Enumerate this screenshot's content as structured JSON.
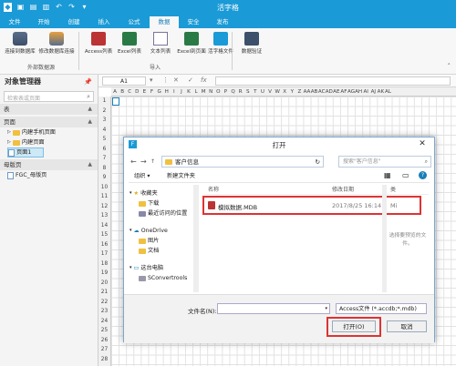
{
  "app": {
    "title": "活字格"
  },
  "tabs": [
    "文件",
    "开始",
    "创建",
    "插入",
    "公式",
    "数据",
    "安全",
    "发布"
  ],
  "active_tab": "数据",
  "ribbon": {
    "btn1": "连接到数据库",
    "btn2": "修改数据库连接",
    "grp1": "外部数据源",
    "btn3": "Access列表",
    "btn4": "Excel列表",
    "btn5": "文本列表",
    "btn6": "Excel到页面",
    "btn7": "活字格文件",
    "grp2": "导入",
    "btn8": "数据验证"
  },
  "sidebar": {
    "title": "对象管理器",
    "search_placeholder": "检索表或页面",
    "sec_table": "表",
    "sec_page": "页面",
    "items": [
      "内建手机页面",
      "内建页面",
      "页面1"
    ],
    "sec_master": "母版页",
    "master_item": "FGC_母版页"
  },
  "formula": {
    "cell": "A1",
    "fx": "fx"
  },
  "grid": {
    "cols": [
      "A",
      "B",
      "C",
      "D",
      "E",
      "F",
      "G",
      "H",
      "I",
      "J",
      "K",
      "L",
      "M",
      "N",
      "O",
      "P",
      "Q",
      "R",
      "S",
      "T",
      "U",
      "V",
      "W",
      "X",
      "Y",
      "Z",
      "AA",
      "AB",
      "AC",
      "AD",
      "AE",
      "AF",
      "AG",
      "AH",
      "AI",
      "AJ",
      "AK",
      "AL"
    ],
    "rows": [
      "1",
      "2",
      "3",
      "4",
      "5",
      "6",
      "7",
      "8",
      "9",
      "10",
      "11",
      "12",
      "13",
      "14",
      "15",
      "16",
      "17",
      "18",
      "19",
      "20",
      "21",
      "22",
      "23",
      "24",
      "25",
      "26",
      "27",
      "28",
      "29"
    ]
  },
  "dialog": {
    "title": "打开",
    "path": "客户信息",
    "search": "搜索\"客户信息\"",
    "organize": "组织 ▾",
    "new_folder": "新建文件夹",
    "left": {
      "favorites": "收藏夹",
      "downloads": "下载",
      "recent": "最近访问的位置",
      "onedrive": "OneDrive",
      "pictures": "图片",
      "documents": "文档",
      "thispc": "这台电脑",
      "drive": "SConvertrools"
    },
    "cols": {
      "name": "名称",
      "date": "修改日期",
      "type": "类"
    },
    "file": {
      "name": "模拟数据.MDB",
      "date": "2017/8/25 16:14",
      "type": "Mi"
    },
    "preview": "选择要预览的文件。",
    "filename_label": "文件名(N):",
    "filetype": "Access文件 (*.accdb;*.mdb)",
    "open": "打开(O)",
    "cancel": "取消"
  },
  "colors": {
    "accent": "#1a9ad6",
    "highlight": "#dd3333"
  }
}
